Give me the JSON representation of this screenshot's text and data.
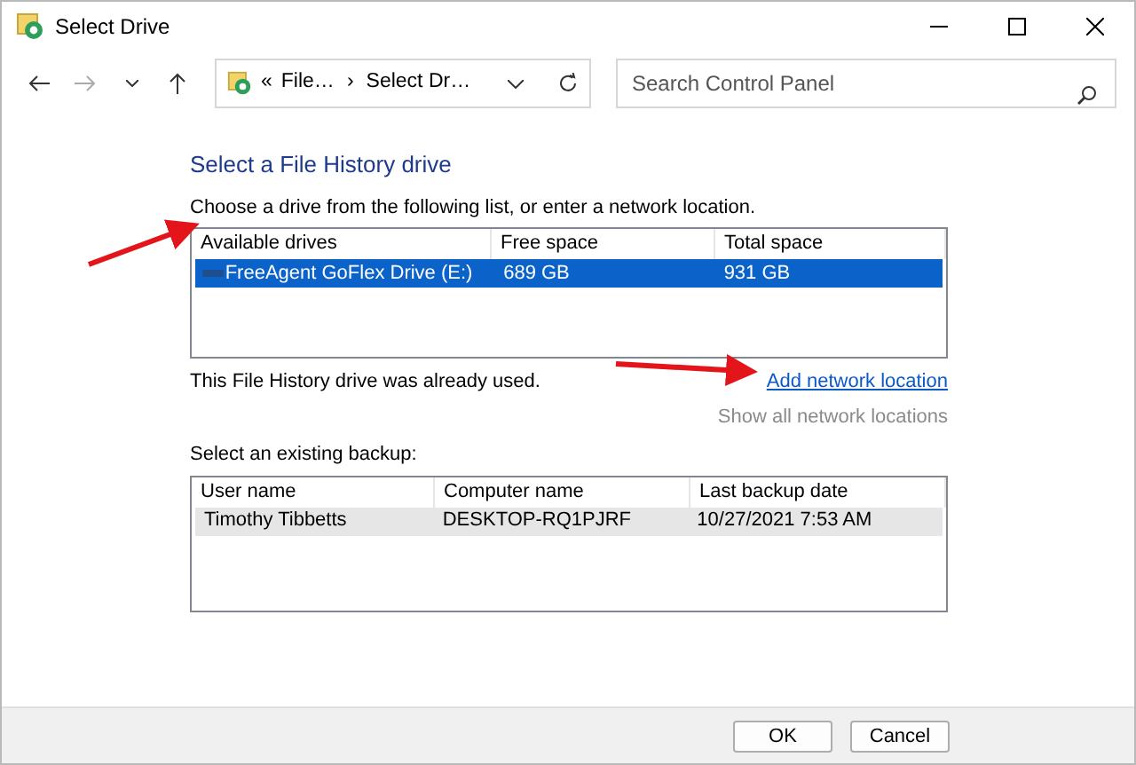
{
  "window": {
    "title": "Select Drive"
  },
  "address_bar": {
    "overflow": "«",
    "separator": "›",
    "crumbs": [
      "File…",
      "Select Dr…"
    ]
  },
  "search": {
    "placeholder": "Search Control Panel"
  },
  "heading": "Select a File History drive",
  "description": "Choose a drive from the following list, or enter a network location.",
  "drives_table": {
    "focused": true,
    "columns": [
      "Available drives",
      "Free space",
      "Total space"
    ],
    "rows": [
      {
        "cells": [
          "FreeAgent GoFlex Drive (E:)",
          "689 GB",
          "931 GB"
        ],
        "selected": true
      }
    ]
  },
  "status": "This File History drive was already used.",
  "links": [
    {
      "label": "Add network location",
      "disabled": false
    },
    {
      "label": "Show all network locations",
      "disabled": true
    }
  ],
  "backup_label": "Select an existing backup:",
  "backups_table": {
    "focused": false,
    "columns": [
      "User name",
      "Computer name",
      "Last backup date"
    ],
    "rows": [
      {
        "cells": [
          "Timothy Tibbetts",
          "DESKTOP-RQ1PJRF",
          "10/27/2021 7:53 AM"
        ],
        "selected": true
      }
    ]
  },
  "buttons": [
    "OK",
    "Cancel"
  ]
}
